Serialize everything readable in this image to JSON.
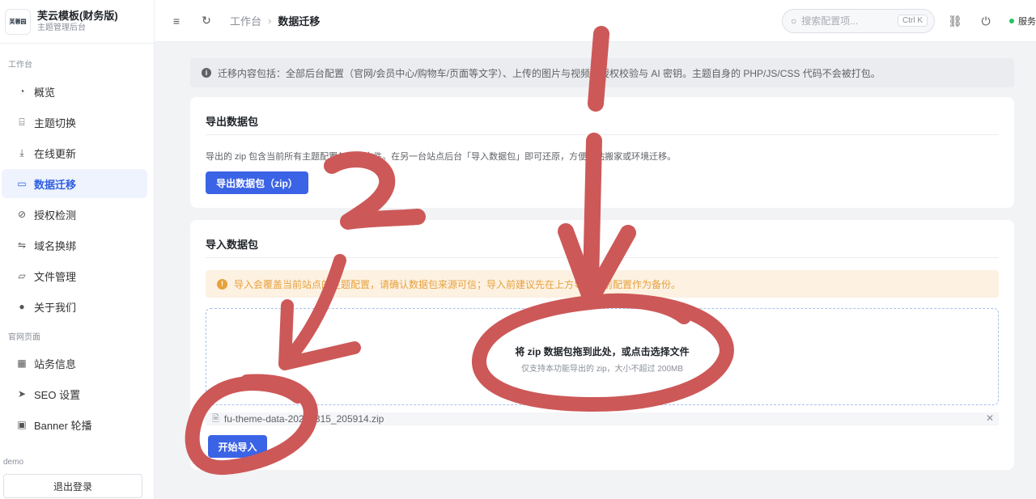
{
  "brand": {
    "logo_text": "芙蓉园",
    "title": "芙云模板(财务版)",
    "subtitle": "主题管理后台"
  },
  "sidebar": {
    "group1_label": "工作台",
    "group1_items": [
      {
        "label": "概览",
        "icon": "dashboard-icon"
      },
      {
        "label": "主题切换",
        "icon": "theme-icon"
      },
      {
        "label": "在线更新",
        "icon": "download-icon"
      },
      {
        "label": "数据迁移",
        "icon": "folder-icon",
        "active": true
      },
      {
        "label": "授权检测",
        "icon": "check-circle-icon"
      },
      {
        "label": "域名换绑",
        "icon": "swap-icon"
      },
      {
        "label": "文件管理",
        "icon": "folder-open-icon"
      },
      {
        "label": "关于我们",
        "icon": "info-icon"
      }
    ],
    "group2_label": "官网页面",
    "group2_items": [
      {
        "label": "站务信息",
        "icon": "building-icon"
      },
      {
        "label": "SEO 设置",
        "icon": "send-icon"
      },
      {
        "label": "Banner 轮播",
        "icon": "image-icon"
      }
    ],
    "user": "demo",
    "logout_label": "退出登录"
  },
  "header": {
    "breadcrumb_root": "工作台",
    "breadcrumb_current": "数据迁移",
    "search_placeholder": "搜索配置项...",
    "search_shortcut": "Ctrl K",
    "status_label": "服务正"
  },
  "main": {
    "info_text": "迁移内容包括：全部后台配置（官网/会员中心/购物车/页面等文字）、上传的图片与视频、授权校验与 AI 密钥。主题自身的 PHP/JS/CSS 代码不会被打包。",
    "export": {
      "title": "导出数据包",
      "desc": "导出的 zip 包含当前所有主题配置与媒体文件。在另一台站点后台「导入数据包」即可还原，方便整站搬家或环境迁移。",
      "button": "导出数据包（zip）"
    },
    "import": {
      "title": "导入数据包",
      "warning": "导入会覆盖当前站点的主题配置，请确认数据包来源可信；导入前建议先在上方导出当前配置作为备份。",
      "drop_title": "将 zip 数据包拖到此处，或点击选择文件",
      "drop_sub": "仅支持本功能导出的 zip，大小不超过 200MB",
      "file_name": "fu-theme-data-20250315_205914.zip",
      "button": "开始导入"
    }
  },
  "annotations": {
    "color": "#cd5858",
    "step1": "1",
    "step2": "2"
  }
}
